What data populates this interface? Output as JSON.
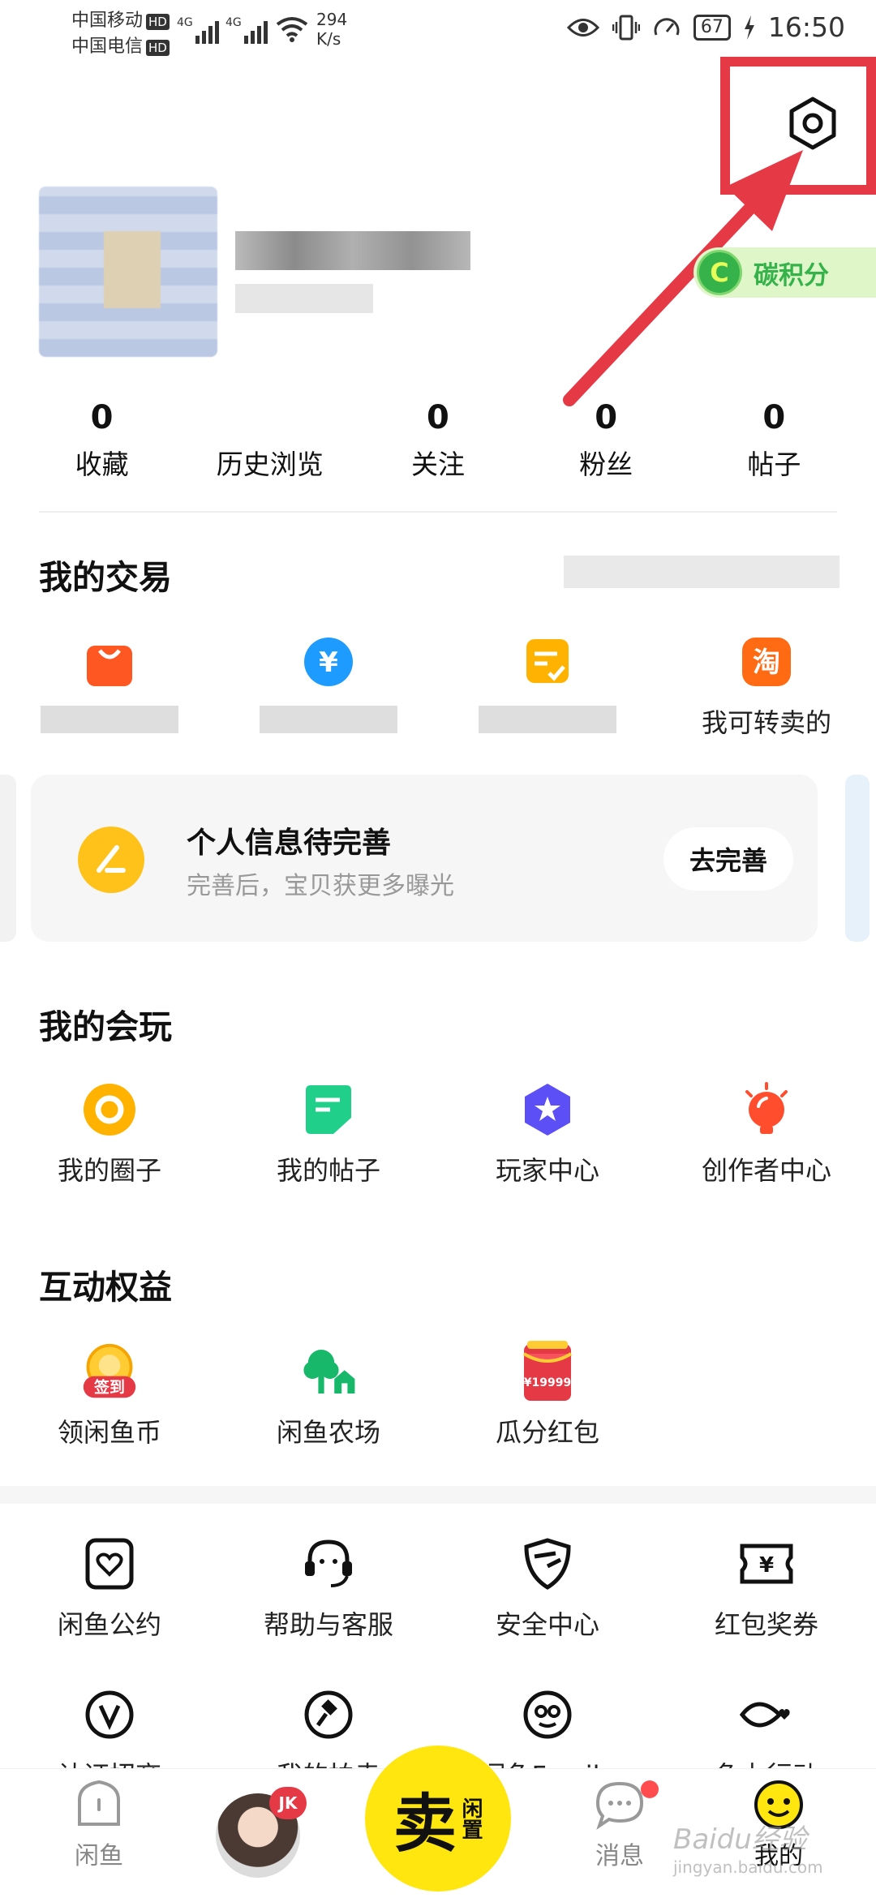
{
  "status_bar": {
    "carrier1": "中国移动",
    "carrier2": "中国电信",
    "hd": "HD",
    "net": "4G",
    "speed_value": "294",
    "speed_unit": "K/s",
    "battery": "67",
    "time": "16:50"
  },
  "profile": {
    "carbon_icon": "C",
    "carbon_label": "碳积分"
  },
  "stats": [
    {
      "num": "0",
      "label": "收藏"
    },
    {
      "num": "",
      "label": "历史浏览"
    },
    {
      "num": "0",
      "label": "关注"
    },
    {
      "num": "0",
      "label": "粉丝"
    },
    {
      "num": "0",
      "label": "帖子"
    }
  ],
  "sections": {
    "trade_title": "我的交易",
    "play_title": "我的会玩",
    "benefit_title": "互动权益"
  },
  "trade_items": [
    {
      "icon": "shopping-bag-icon",
      "label": ""
    },
    {
      "icon": "yen-coin-icon",
      "label": ""
    },
    {
      "icon": "order-check-icon",
      "label": ""
    },
    {
      "icon": "taobao-icon",
      "glyph": "淘",
      "label": "我可转卖的"
    }
  ],
  "profile_card": {
    "title": "个人信息待完善",
    "subtitle": "完善后，宝贝获更多曝光",
    "button": "去完善"
  },
  "play_items": [
    {
      "icon": "circle-ring-icon",
      "label": "我的圈子"
    },
    {
      "icon": "post-icon",
      "label": "我的帖子"
    },
    {
      "icon": "star-badge-icon",
      "label": "玩家中心"
    },
    {
      "icon": "lightbulb-icon",
      "label": "创作者中心"
    }
  ],
  "benefit_items": [
    {
      "icon": "checkin-coin-icon",
      "badge": "签到",
      "label": "领闲鱼币"
    },
    {
      "icon": "farm-tree-icon",
      "label": "闲鱼农场"
    },
    {
      "icon": "red-packet-icon",
      "badge": "¥19999",
      "label": "瓜分红包"
    }
  ],
  "service_items": [
    {
      "icon": "heart-doc-icon",
      "label": "闲鱼公约"
    },
    {
      "icon": "headset-icon",
      "label": "帮助与客服"
    },
    {
      "icon": "shield-icon",
      "label": "安全中心"
    },
    {
      "icon": "voucher-icon",
      "label": "红包奖券"
    }
  ],
  "service_items_row2": [
    {
      "icon": "verified-v-icon",
      "label": "认证招商"
    },
    {
      "icon": "auction-hammer-icon",
      "label": "我的拍卖"
    },
    {
      "icon": "monkey-face-icon",
      "label": "闲鱼Family"
    },
    {
      "icon": "fish-heart-icon",
      "label": "鱼力行动"
    }
  ],
  "tabbar": {
    "home": "闲鱼",
    "sell_main": "卖",
    "sell_side": "闲置",
    "badge": "JK",
    "messages": "消息",
    "mine": "我的"
  },
  "watermark": {
    "line1": "Baidu经验",
    "line2": "jingyan.baidu.com"
  },
  "colors": {
    "accent_yellow": "#ffe60f",
    "highlight_red": "#e63946",
    "carbon_green": "#35b34a"
  }
}
